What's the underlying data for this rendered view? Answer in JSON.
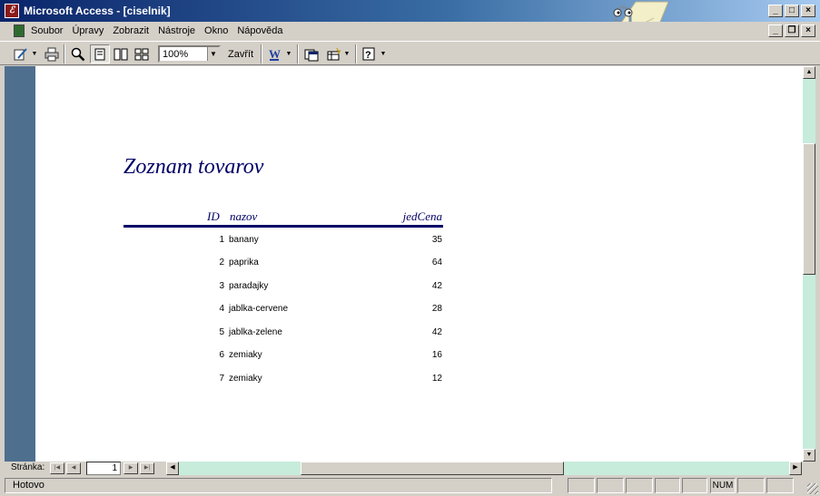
{
  "window": {
    "title": "Microsoft Access - [ciselnik]"
  },
  "menu": {
    "items": [
      "Soubor",
      "Úpravy",
      "Zobrazit",
      "Nástroje",
      "Okno",
      "Nápověda"
    ]
  },
  "toolbar": {
    "zoom_value": "100%",
    "close_label": "Zavřít"
  },
  "report": {
    "title": "Zoznam tovarov",
    "headers": {
      "id": "ID",
      "name": "nazov",
      "price": "jedCena"
    },
    "rows": [
      {
        "id": "1",
        "name": "banany",
        "price": "35"
      },
      {
        "id": "2",
        "name": "paprika",
        "price": "64"
      },
      {
        "id": "3",
        "name": "paradajky",
        "price": "42"
      },
      {
        "id": "4",
        "name": "jablka-cervene",
        "price": "28"
      },
      {
        "id": "5",
        "name": "jablka-zelene",
        "price": "42"
      },
      {
        "id": "6",
        "name": "zemiaky",
        "price": "16"
      },
      {
        "id": "7",
        "name": "zemiaky",
        "price": "12"
      }
    ]
  },
  "navigation": {
    "label": "Stránka:",
    "page": "1"
  },
  "status": {
    "text": "Hotovo",
    "num_indicator": "NUM"
  }
}
